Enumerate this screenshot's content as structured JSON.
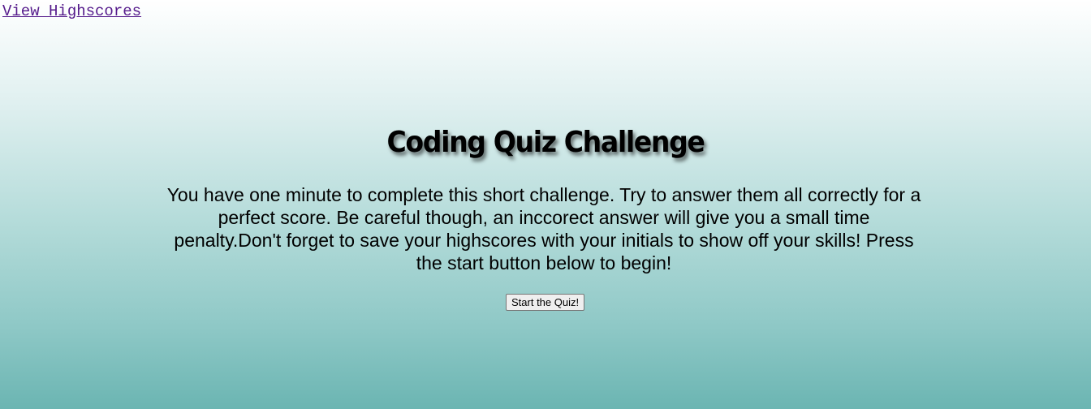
{
  "header": {
    "highscores_link": "View Highscores"
  },
  "main": {
    "title": "Coding Quiz Challenge",
    "intro": "You have one minute to complete this short challenge. Try to answer them all correctly for a perfect score. Be careful though, an inccorect answer will give you a small time penalty.Don't forget to save your highscores with your initials to show off your skills! Press the start button below to begin!",
    "start_button": "Start the Quiz!"
  },
  "colors": {
    "link_visited": "#551a8b",
    "gradient_top": "#ffffff",
    "gradient_bottom": "#6bb5b2"
  }
}
